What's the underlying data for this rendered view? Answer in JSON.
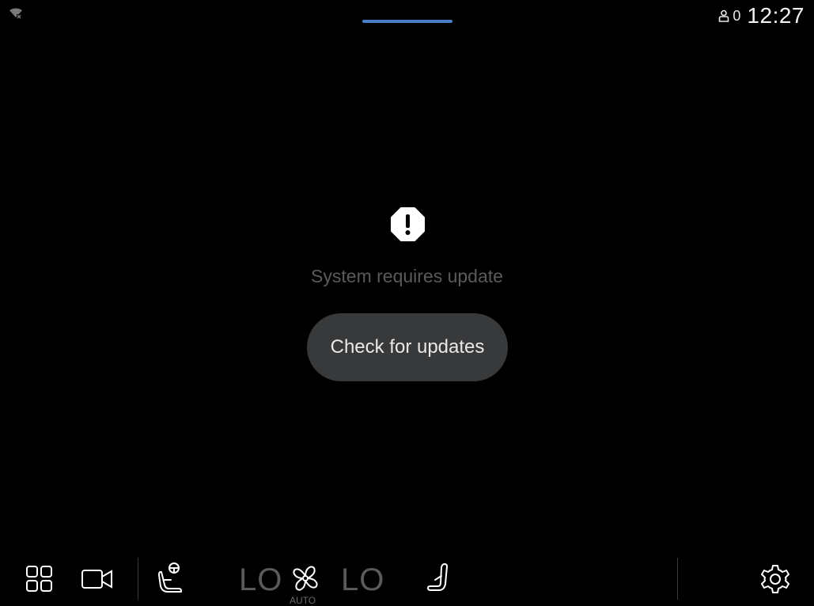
{
  "status_bar": {
    "profile_count": "0",
    "clock": "12:27"
  },
  "main": {
    "icon": "warning-octagon-icon",
    "message": "System requires update",
    "button_label": "Check for updates"
  },
  "bottom_bar": {
    "icons": [
      "app-grid-icon",
      "camera-icon",
      "driver-seat-heat-icon",
      "fan-icon",
      "passenger-seat-icon",
      "settings-icon"
    ],
    "left_temp": "LO",
    "right_temp": "LO",
    "fan_mode": "AUTO"
  },
  "colors": {
    "background": "#000000",
    "accent_handle": "#4a7fc7",
    "button_bg": "#38393b",
    "muted_text": "#5a5a5a"
  }
}
